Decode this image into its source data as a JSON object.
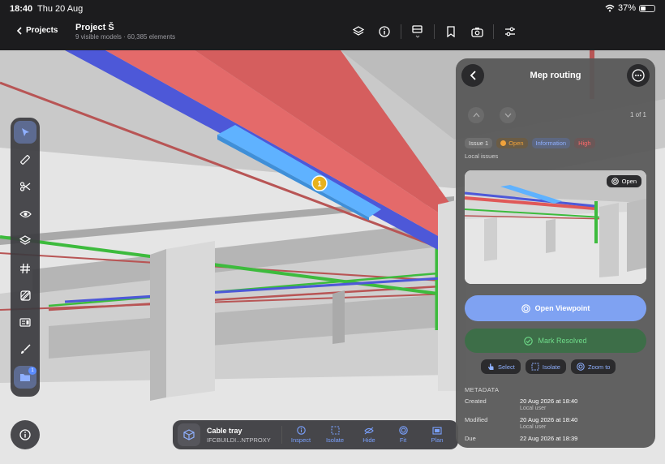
{
  "status": {
    "time": "18:40",
    "date": "Thu 20 Aug",
    "battery": "37%"
  },
  "header": {
    "back_label": "Projects",
    "title": "Project Š",
    "subtitle": "9 visible models · 60,385 elements",
    "toolbar_icons": [
      "layers-icon",
      "info-icon",
      "section-box-icon",
      "bookmark-icon",
      "camera-icon",
      "settings-sliders-icon"
    ]
  },
  "viewport": {
    "issue_marker": "1",
    "colors": {
      "duct_red": "#e46a6a",
      "duct_blue": "#4d58d8",
      "selected": "#5fb2ff",
      "pipe_green": "#3dbb3d",
      "marker": "#e8b21d"
    }
  },
  "rail": {
    "tools": [
      "select-arrow-icon",
      "measure-ruler-icon",
      "cut-scissors-icon",
      "visibility-eye-icon",
      "layers-icon",
      "grid-hash-icon",
      "hatch-icon",
      "id-card-icon",
      "paintbrush-icon",
      "issues-folder-icon"
    ],
    "issues_badge": "1"
  },
  "selection": {
    "name": "Cable tray",
    "type": "IFCBUILDI...NTPROXY",
    "actions": [
      "Inspect",
      "Isolate",
      "Hide",
      "Fit",
      "Plan"
    ]
  },
  "panel": {
    "title": "Mep routing",
    "counter": "1 of 1",
    "tags": {
      "issue": "Issue 1",
      "status": "Open",
      "type": "Information",
      "priority": "High"
    },
    "source": "Local issues",
    "thumb_badge": "Open",
    "open_viewpoint": "Open Viewpoint",
    "mark_resolved": "Mark Resolved",
    "quick_actions": [
      "Select",
      "Isolate",
      "Zoom to"
    ],
    "metadata_heading": "METADATA",
    "metadata": [
      {
        "key": "Created",
        "value": "20 Aug 2026 at 18:40",
        "sub": "Local user"
      },
      {
        "key": "Modified",
        "value": "20 Aug 2026 at 18:40",
        "sub": "Local user"
      },
      {
        "key": "Due",
        "value": "22 Aug 2026 at 18:39",
        "sub": ""
      }
    ]
  }
}
